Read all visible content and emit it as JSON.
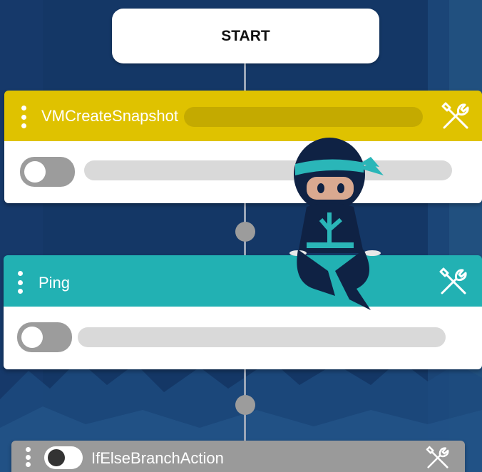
{
  "start": {
    "label": "START"
  },
  "steps": [
    {
      "title": "VMCreateSnapshot",
      "header_color": "#dfc200",
      "enabled": false
    },
    {
      "title": "Ping",
      "header_color": "#22b1b3",
      "enabled": false
    },
    {
      "title": "IfElseBranchAction",
      "header_color": "#9a9a9a",
      "enabled": false
    }
  ],
  "icons": {
    "tools": "wrench-screwdriver-icon",
    "drag": "vertical-dots-icon",
    "mascot": "ninja-mascot"
  },
  "colors": {
    "background": "#143766",
    "toggle_off": "#9c9c9c",
    "placeholder_bar": "#d9d9d9"
  }
}
